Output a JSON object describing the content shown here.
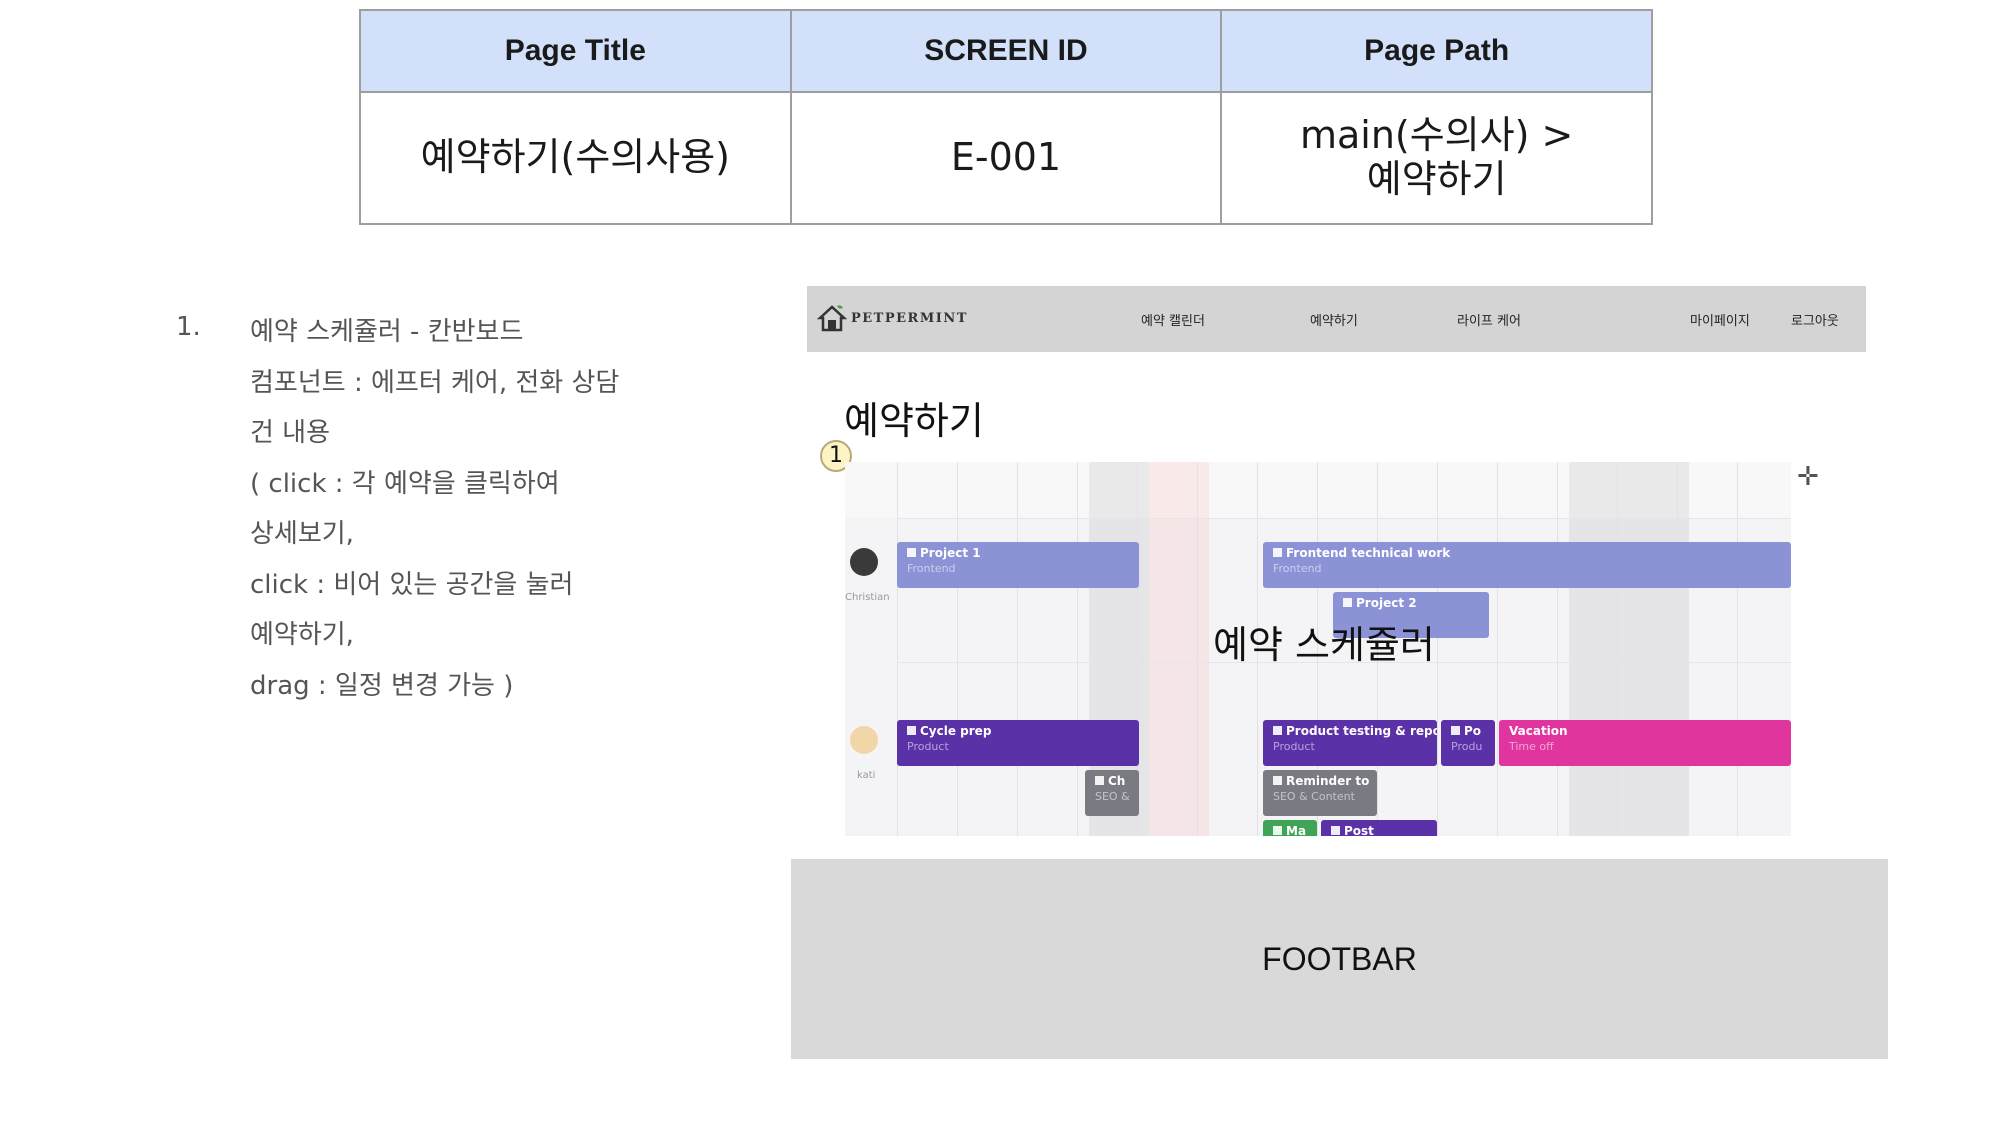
{
  "meta_table": {
    "headers": [
      "Page Title",
      "SCREEN ID",
      "Page Path"
    ],
    "page_title": "예약하기(수의사용)",
    "screen_id": "E-001",
    "page_path_line1": "main(수의사) >",
    "page_path_line2": "예약하기"
  },
  "description": {
    "number": "1.",
    "lines": [
      "예약 스케쥴러 - 칸반보드",
      "컴포넌트 : 에프터 케어, 전화 상담",
      "건 내용",
      "( click : 각 예약을 클릭하여",
      "상세보기,",
      "click : 비어 있는 공간을 눌러",
      "예약하기,",
      "drag : 일정 변경 가능 )"
    ]
  },
  "navbar": {
    "logo_text": "PETPERMINT",
    "items": [
      "예약 캘린더",
      "예약하기",
      "라이프 케어",
      "마이페이지",
      "로그아웃"
    ]
  },
  "page_heading": "예약하기",
  "marker": "1",
  "scheduler": {
    "label": "예약 스케쥴러",
    "people": [
      "Christian",
      "kati"
    ],
    "events": [
      {
        "title": "Project 1",
        "sub": "Frontend",
        "color": "#8b93d6"
      },
      {
        "title": "Frontend technical work",
        "sub": "Frontend",
        "color": "#8b93d6"
      },
      {
        "title": "Project 2",
        "sub": "",
        "color": "#8b93d6"
      },
      {
        "title": "Cycle prep",
        "sub": "Product",
        "color": "#5b31a8"
      },
      {
        "title": "Product testing & repo",
        "sub": "Product",
        "color": "#5b31a8"
      },
      {
        "title": "Po",
        "sub": "Produ",
        "color": "#5b31a8"
      },
      {
        "title": "Vacation",
        "sub": "Time off",
        "color": "#e0359f"
      },
      {
        "title": "Ch",
        "sub": "SEO &",
        "color": "#7a7a82"
      },
      {
        "title": "Reminder to",
        "sub": "SEO & Content",
        "color": "#7a7a82"
      },
      {
        "title": "Ma",
        "sub": "",
        "color": "#3fa455"
      },
      {
        "title": "Post",
        "sub": "",
        "color": "#5b31a8"
      }
    ]
  },
  "footbar": "FOOTBAR"
}
